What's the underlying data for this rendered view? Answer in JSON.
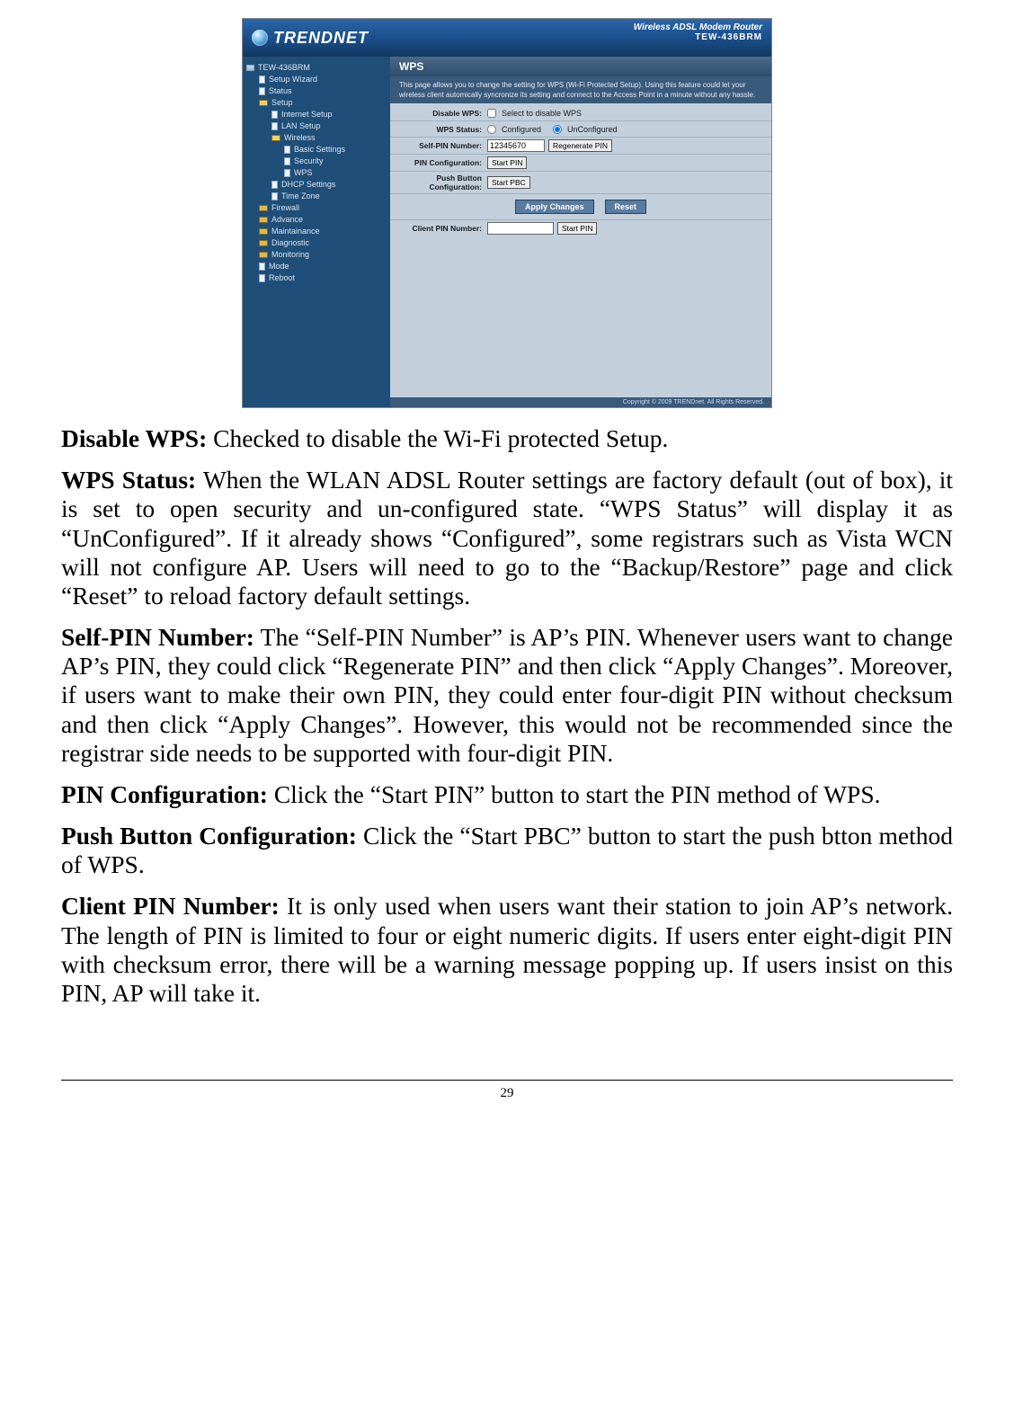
{
  "shot": {
    "brand": "TRENDNET",
    "product_line1": "Wireless ADSL Modem Router",
    "product_line2": "TEW-436BRM",
    "section_title": "WPS",
    "section_desc": "This page allows you to change the setting for WPS (Wi-Fi Protected Setup). Using this feature could let your wireless client automically syncronize its setting and connect to the Access Point in a minute without any hassle.",
    "rows": {
      "disable_wps_label": "Disable WPS:",
      "disable_wps_text": "Select to disable WPS",
      "wps_status_label": "WPS Status:",
      "wps_status_opt1": "Configured",
      "wps_status_opt2": "UnConfigured",
      "self_pin_label": "Self-PIN Number:",
      "self_pin_value": "12345670",
      "regen_pin_btn": "Regenerate PIN",
      "pin_conf_label": "PIN Configuration:",
      "start_pin_btn": "Start PIN",
      "push_btn_label": "Push Button Configuration:",
      "start_pbc_btn": "Start PBC",
      "apply_btn": "Apply Changes",
      "reset_btn": "Reset",
      "client_pin_label": "Client PIN Number:",
      "client_pin_value": "",
      "client_start_pin_btn": "Start PIN"
    },
    "tree": [
      {
        "lvl": 0,
        "icon": "pc",
        "label": "TEW-436BRM"
      },
      {
        "lvl": 1,
        "icon": "page",
        "label": "Setup Wizard"
      },
      {
        "lvl": 1,
        "icon": "page",
        "label": "Status"
      },
      {
        "lvl": 1,
        "icon": "folder-open",
        "label": "Setup"
      },
      {
        "lvl": 2,
        "icon": "page",
        "label": "Internet Setup"
      },
      {
        "lvl": 2,
        "icon": "page",
        "label": "LAN Setup"
      },
      {
        "lvl": 2,
        "icon": "folder-open",
        "label": "Wireless"
      },
      {
        "lvl": 3,
        "icon": "page",
        "label": "Basic Settings"
      },
      {
        "lvl": 3,
        "icon": "page",
        "label": "Security"
      },
      {
        "lvl": 3,
        "icon": "page",
        "label": "WPS"
      },
      {
        "lvl": 2,
        "icon": "page",
        "label": "DHCP Settings"
      },
      {
        "lvl": 2,
        "icon": "page",
        "label": "Time Zone"
      },
      {
        "lvl": 1,
        "icon": "folder",
        "label": "Firewall"
      },
      {
        "lvl": 1,
        "icon": "folder",
        "label": "Advance"
      },
      {
        "lvl": 1,
        "icon": "folder",
        "label": "Maintainance"
      },
      {
        "lvl": 1,
        "icon": "folder",
        "label": "Diagnostic"
      },
      {
        "lvl": 1,
        "icon": "folder",
        "label": "Monitoring"
      },
      {
        "lvl": 1,
        "icon": "page",
        "label": "Mode"
      },
      {
        "lvl": 1,
        "icon": "page",
        "label": "Reboot"
      }
    ],
    "copyright": "Copyright © 2009 TRENDnet. All Rights Reserved."
  },
  "doc": {
    "p1_bold": "Disable WPS:",
    "p1_text": "  Checked to disable the Wi-Fi protected Setup.",
    "p2_bold": "WPS Status:",
    "p2_text": "  When the WLAN ADSL Router settings are factory default (out of box), it is set to open security and un-configured state. “WPS Status” will display it as “UnConfigured”. If it already shows “Configured”, some registrars such as Vista WCN will not configure AP. Users will need to go to the “Backup/Restore” page and click “Reset” to reload factory default settings.",
    "p3_bold": "Self-PIN Number:",
    "p3_text": "  The “Self-PIN Number” is AP’s PIN. Whenever users want to change AP’s PIN, they could click “Regenerate PIN” and then click “Apply Changes”. Moreover, if users want to make their own PIN, they could enter four-digit PIN without checksum and then click “Apply Changes”. However, this would not be recommended since the registrar side needs to be supported with four-digit PIN.",
    "p4_bold": "PIN Configuration:",
    "p4_text": "  Click the “Start PIN” button to start the PIN method of WPS.",
    "p5_bold": "Push Button Configuration:",
    "p5_text": "  Click the “Start PBC” button to start the push btton method of WPS.",
    "p6_bold": "Client PIN Number:",
    "p6_text": "  It is only used when users want their station to join AP’s network. The length of PIN is limited to four or eight numeric digits. If users enter eight-digit PIN with checksum error, there will be a warning message popping up. If users insist on this PIN, AP will take it.",
    "page_number": "29"
  }
}
